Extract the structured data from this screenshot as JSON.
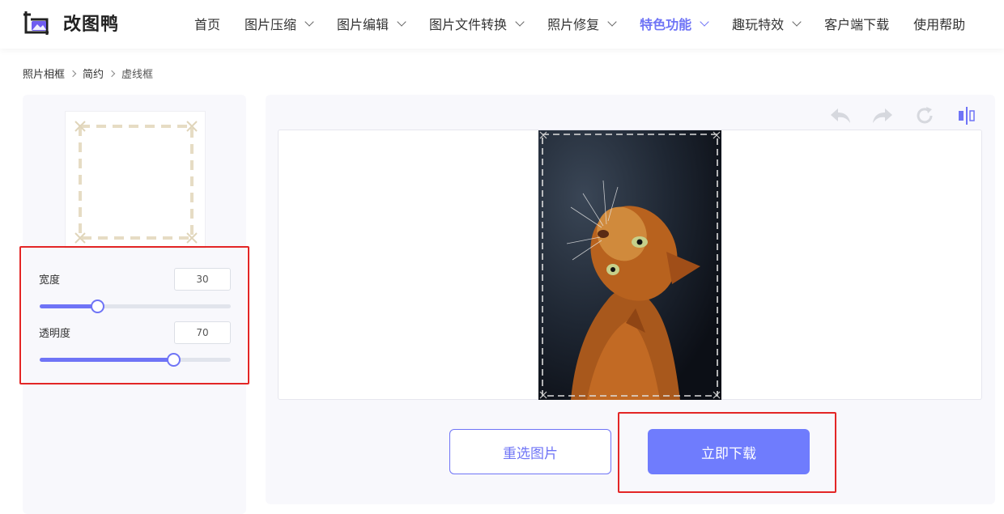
{
  "header": {
    "logo_text": "改图鸭",
    "nav": [
      {
        "label": "首页",
        "has_dropdown": false,
        "active": false
      },
      {
        "label": "图片压缩",
        "has_dropdown": true,
        "active": false
      },
      {
        "label": "图片编辑",
        "has_dropdown": true,
        "active": false
      },
      {
        "label": "图片文件转换",
        "has_dropdown": true,
        "active": false
      },
      {
        "label": "照片修复",
        "has_dropdown": true,
        "active": false
      },
      {
        "label": "特色功能",
        "has_dropdown": true,
        "active": true
      },
      {
        "label": "趣玩特效",
        "has_dropdown": true,
        "active": false
      },
      {
        "label": "客户端下载",
        "has_dropdown": false,
        "active": false
      },
      {
        "label": "使用帮助",
        "has_dropdown": false,
        "active": false
      }
    ]
  },
  "breadcrumb": [
    "照片相框",
    "简约",
    "虚线框"
  ],
  "controls": {
    "width": {
      "label": "宽度",
      "value": "30",
      "fraction": 0.3
    },
    "opacity": {
      "label": "透明度",
      "value": "70",
      "fraction": 0.7
    }
  },
  "toolbar": {
    "icons": [
      "undo-icon",
      "redo-icon",
      "refresh-icon",
      "compare-icon"
    ]
  },
  "actions": {
    "reselect_label": "重选图片",
    "download_label": "立即下载"
  },
  "colors": {
    "accent": "#6f74f6",
    "download_bg": "#6f7cfd",
    "highlight_red": "#e32626",
    "panel_bg": "#f8f8fc"
  }
}
